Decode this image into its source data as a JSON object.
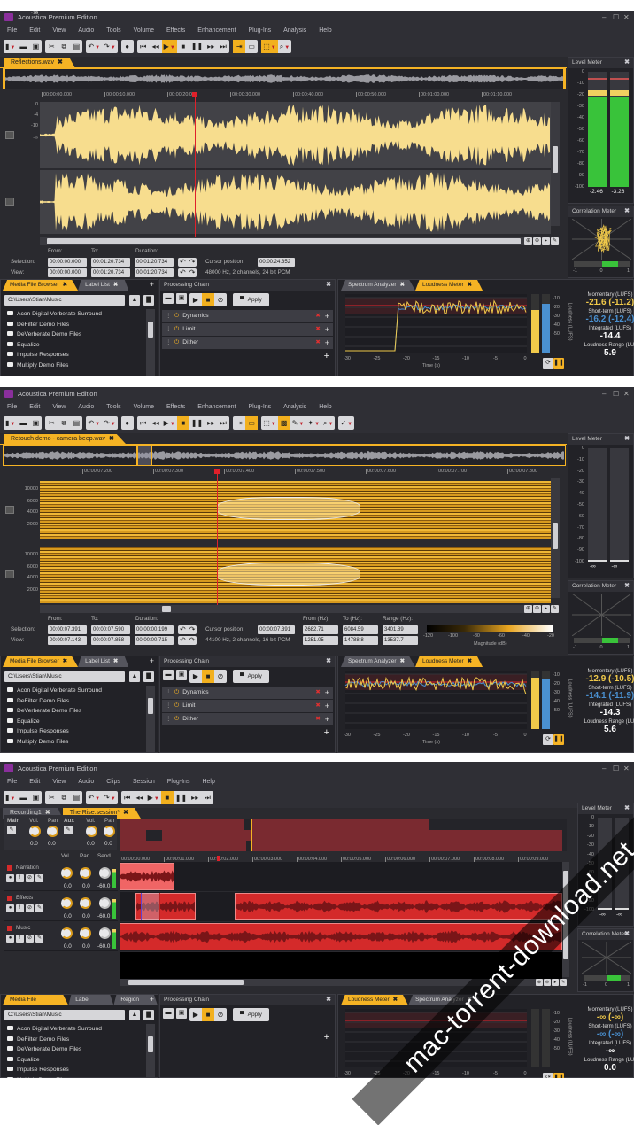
{
  "colors": {
    "accent": "#f5b324",
    "waveform": "#f7dd8e",
    "clip": "#d42a2a",
    "momentary": "#f0c94a",
    "shortterm": "#4a90d0",
    "meter_green": "#39c33a"
  },
  "windows": [
    {
      "title": "Acoustica Premium Edition",
      "menu": [
        "File",
        "Edit",
        "View",
        "Audio",
        "Tools",
        "Volume",
        "Effects",
        "Enhancement",
        "Plug-Ins",
        "Analysis",
        "Help"
      ],
      "toolbar": [
        [
          "new-file",
          "open",
          "save"
        ],
        [
          "cut",
          "copy",
          "paste"
        ],
        [
          "undo",
          "redo"
        ],
        [
          "record"
        ],
        [
          "go-to-start",
          "rewind",
          "play",
          "stop",
          "pause",
          "fast-forward",
          "go-to-end"
        ],
        [
          "loop",
          "view-toggle"
        ],
        [
          "select-tool",
          "zoom-tool"
        ]
      ],
      "toolbar_active": [
        "play",
        "loop",
        "select-tool"
      ],
      "document_tab": "Reflections.wav",
      "ruler": [
        "00:00:00.000",
        "00:00:10.000",
        "00:00:20.000",
        "00:00:30.000",
        "00:00:40.000",
        "00:00:50.000",
        "00:01:00.000",
        "00:01:10.000"
      ],
      "axis": [
        "0",
        "-4",
        "-10",
        "-∞",
        "-10",
        "-4",
        "0"
      ],
      "view_type": "waveform",
      "info": {
        "from_label": "From:",
        "to_label": "To:",
        "duration_label": "Duration:",
        "selection_label": "Selection:",
        "view_label": "View:",
        "selection": {
          "from": "00:00:00.000",
          "to": "00:01:20.734",
          "duration": "00:01:20.734"
        },
        "view": {
          "from": "00:00:00.000",
          "to": "00:01:20.734",
          "duration": "00:01:20.734"
        },
        "cursor_label": "Cursor position:",
        "cursor": "00:00:24.352",
        "format": "48000 Hz, 2 channels, 24 bit PCM"
      },
      "browser": {
        "tabs": [
          "Media File Browser",
          "Label List"
        ],
        "path": "C:\\Users\\Stian\\Music",
        "items": [
          "Acon Digital Verberate Surround",
          "DeFilter Demo Files",
          "DeVerberate Demo Files",
          "Equalize",
          "Impulse Responses",
          "Multiply Demo Files"
        ]
      },
      "chain": {
        "title": "Processing Chain",
        "apply": "Apply",
        "items": [
          "Dynamics",
          "Limit",
          "Dither"
        ]
      },
      "analyzer": {
        "tabs": [
          "Spectrum Analyzer",
          "Loudness Meter"
        ],
        "x_ticks": [
          "-30",
          "-25",
          "-20",
          "-15",
          "-10",
          "-5",
          "0"
        ],
        "y_ticks": [
          "-10",
          "-20",
          "-30",
          "-40",
          "-50"
        ],
        "xlabel": "Time (s)",
        "ylabel": "Loudness (LUFS)",
        "momentary_label": "Momentary (LUFS)",
        "momentary": "-21.6 (-11.2)",
        "shortterm_label": "Short-term (LUFS)",
        "shortterm": "-16.2 (-12.4)",
        "integrated_label": "Integrated (LUFS)",
        "integrated": "-14.4",
        "range_label": "Loudness Range (LU)",
        "range": "5.9",
        "bar_m": 0.72,
        "bar_s": 0.83
      },
      "level_meter": {
        "title": "Level Meter",
        "scale": [
          "0",
          "-10",
          "-20",
          "-30",
          "-40",
          "-50",
          "-60",
          "-70",
          "-80",
          "-90",
          "-100"
        ],
        "left": "-2.46",
        "right": "-3.26",
        "fill": 0.9
      },
      "correlation": {
        "title": "Correlation Meter",
        "scale": [
          "-1",
          "0",
          "1"
        ],
        "value": 0.6
      }
    },
    {
      "title": "Acoustica Premium Edition",
      "menu": [
        "File",
        "Edit",
        "View",
        "Audio",
        "Tools",
        "Volume",
        "Effects",
        "Enhancement",
        "Plug-Ins",
        "Analysis",
        "Help"
      ],
      "toolbar": [
        [
          "new-file",
          "open",
          "save"
        ],
        [
          "cut",
          "copy",
          "paste"
        ],
        [
          "undo",
          "redo"
        ],
        [
          "record"
        ],
        [
          "go-to-start",
          "rewind",
          "play",
          "stop",
          "pause",
          "fast-forward",
          "go-to-end"
        ],
        [
          "loop",
          "view-toggle"
        ],
        [
          "select-tool",
          "spectral-view",
          "brush-tool",
          "magic-wand",
          "zoom-tool"
        ],
        [
          "retouch-tool"
        ]
      ],
      "toolbar_active": [
        "stop",
        "view-toggle",
        "spectral-view"
      ],
      "document_tab": "Retouch demo - camera beep.wav",
      "ruler": [
        "00:00:07.200",
        "00:00:07.300",
        "00:00:07.400",
        "00:00:07.500",
        "00:00:07.600",
        "00:00:07.700",
        "00:00:07.800"
      ],
      "axis": [
        "10000",
        "6000",
        "4000",
        "2000",
        "10000",
        "6000",
        "4000",
        "2000"
      ],
      "view_type": "spectrogram",
      "info": {
        "from_label": "From:",
        "to_label": "To:",
        "duration_label": "Duration:",
        "selection_label": "Selection:",
        "view_label": "View:",
        "selection": {
          "from": "00:00:07.391",
          "to": "00:00:07.590",
          "duration": "00:00:00.199"
        },
        "view": {
          "from": "00:00:07.143",
          "to": "00:00:07.858",
          "duration": "00:00:00.715"
        },
        "cursor_label": "Cursor position:",
        "cursor": "00:00:07.391",
        "format": "44100 Hz, 2 channels, 16 bit PCM",
        "hz": {
          "from_label": "From (Hz):",
          "to_label": "To (Hz):",
          "range_label": "Range (Hz):",
          "selection": {
            "from": "2682.71",
            "to": "6084.59",
            "range": "3401.89"
          },
          "view": {
            "from": "1251.05",
            "to": "14788.8",
            "range": "13537.7"
          }
        },
        "magnitude": {
          "ticks": [
            "-120",
            "-100",
            "-80",
            "-60",
            "-40",
            "-20"
          ],
          "label": "Magnitude (dB)"
        }
      },
      "browser": {
        "tabs": [
          "Media File Browser",
          "Label List"
        ],
        "path": "C:\\Users\\Stian\\Music",
        "items": [
          "Acon Digital Verberate Surround",
          "DeFilter Demo Files",
          "DeVerberate Demo Files",
          "Equalize",
          "Impulse Responses",
          "Multiply Demo Files"
        ]
      },
      "chain": {
        "title": "Processing Chain",
        "apply": "Apply",
        "items": [
          "Dynamics",
          "Limit",
          "Dither"
        ]
      },
      "analyzer": {
        "tabs": [
          "Spectrum Analyzer",
          "Loudness Meter"
        ],
        "x_ticks": [
          "-30",
          "-25",
          "-20",
          "-15",
          "-10",
          "-5",
          "0"
        ],
        "y_ticks": [
          "-10",
          "-20",
          "-30",
          "-40",
          "-50"
        ],
        "xlabel": "Time (s)",
        "ylabel": "Loudness (LUFS)",
        "momentary_label": "Momentary (LUFS)",
        "momentary": "-12.9 (-10.5)",
        "shortterm_label": "Short-term (LUFS)",
        "shortterm": "-14.1 (-11.9)",
        "integrated_label": "Integrated (LUFS)",
        "integrated": "-14.3",
        "range_label": "Loudness Range (LU)",
        "range": "5.6",
        "bar_m": 0.88,
        "bar_s": 0.85
      },
      "level_meter": {
        "title": "Level Meter",
        "scale": [
          "0",
          "-10",
          "-20",
          "-30",
          "-40",
          "-50",
          "-60",
          "-70",
          "-80",
          "-90",
          "-100"
        ],
        "left": "-∞",
        "right": "-∞",
        "fill": 0
      },
      "correlation": {
        "title": "Correlation Meter",
        "scale": [
          "-1",
          "0",
          "1"
        ],
        "value": 0.6
      }
    }
  ],
  "session": {
    "title": "Acoustica Premium Edition",
    "menu": [
      "File",
      "Edit",
      "View",
      "Audio",
      "Clips",
      "Session",
      "Plug-Ins",
      "Help"
    ],
    "toolbar": [
      [
        "new-file",
        "open",
        "save"
      ],
      [
        "cut",
        "copy",
        "paste"
      ],
      [
        "undo",
        "redo"
      ],
      [
        "go-to-start",
        "rewind",
        "play",
        "stop",
        "pause",
        "fast-forward",
        "go-to-end"
      ]
    ],
    "toolbar_active": [
      "stop"
    ],
    "tabs": [
      "Recording1",
      "The Rise.session*"
    ],
    "mixer": {
      "main": "Main",
      "aux": "Aux",
      "vol": "Vol.",
      "pan": "Pan",
      "values": [
        "0.0",
        "0.0",
        "0.0",
        "0.0"
      ]
    },
    "track_headers": {
      "vol": "Vol.",
      "pan": "Pan",
      "send": "Send"
    },
    "tracks": [
      {
        "name": "Narration",
        "vol": "0.0",
        "pan": "0.0",
        "send": "-60.0"
      },
      {
        "name": "Effects",
        "vol": "0.0",
        "pan": "0.0",
        "send": "-60.0"
      },
      {
        "name": "Music",
        "vol": "0.0",
        "pan": "0.0",
        "send": "-60.0"
      }
    ],
    "ruler": [
      "00:00:00.000",
      "00:00:01.000",
      "00:00:02.000",
      "00:00:03.000",
      "00:00:04.000",
      "00:00:05.000",
      "00:00:06.000",
      "00:00:07.000",
      "00:00:08.000",
      "00:00:09.000"
    ],
    "browser": {
      "tabs": [
        "Media File Browser",
        "Label List",
        "Region L"
      ],
      "path": "C:\\Users\\Stian\\Music",
      "items": [
        "Acon Digital Verberate Surround",
        "DeFilter Demo Files",
        "DeVerberate Demo Files",
        "Equalize",
        "Impulse Responses",
        "Multiply Demo Files"
      ]
    },
    "chain": {
      "title": "Processing Chain",
      "apply": "Apply"
    },
    "analyzer": {
      "tabs": [
        "Loudness Meter",
        "Spectrum Analyzer"
      ],
      "x_ticks": [
        "-30",
        "-25",
        "-20",
        "-15",
        "-10",
        "-5",
        "0"
      ],
      "y_ticks": [
        "-10",
        "-20",
        "-30",
        "-40",
        "-50"
      ],
      "xlabel": "Time (s)",
      "ylabel": "Loudness (LUFS)",
      "momentary_label": "Momentary (LUFS)",
      "momentary": "-∞ (-∞)",
      "shortterm_label": "Short-term (LUFS)",
      "shortterm": "-∞ (-∞)",
      "integrated_label": "Integrated (LUFS)",
      "integrated": "-∞",
      "range_label": "Loudness Range (LU)",
      "range": "0.0"
    },
    "level_meter": {
      "title": "Level Meter",
      "scale": [
        "0",
        "-10",
        "-20",
        "-30",
        "-40",
        "-50",
        "-60",
        "-70",
        "-80",
        "-90",
        "-100"
      ],
      "left": "-∞",
      "right": "-∞"
    },
    "correlation": {
      "title": "Correlation Meter",
      "scale": [
        "-1",
        "0",
        "1"
      ],
      "value": 0.6
    }
  },
  "watermark": "mac-torrent-download.net"
}
